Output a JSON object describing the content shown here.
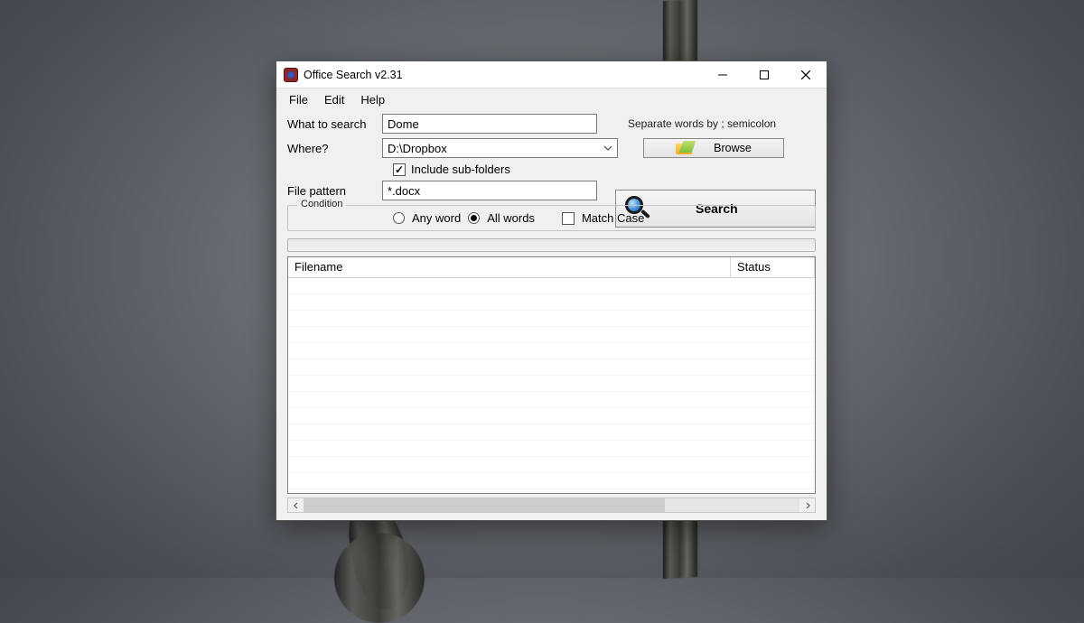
{
  "window": {
    "title": "Office Search v2.31"
  },
  "menu": {
    "file": "File",
    "edit": "Edit",
    "help": "Help"
  },
  "form": {
    "what_label": "What to search",
    "what_value": "Dome",
    "hint": "Separate words by ; semicolon",
    "where_label": "Where?",
    "where_value": "D:\\Dropbox",
    "browse_label": "Browse",
    "include_sub_label": "Include sub-folders",
    "include_sub_checked": true,
    "pattern_label": "File pattern",
    "pattern_value": "*.docx",
    "search_label": "Search"
  },
  "condition": {
    "legend": "Condition",
    "any_word": "Any word",
    "all_words": "All words",
    "selected": "all",
    "match_case_label": "Match Case",
    "match_case_checked": false
  },
  "results": {
    "col_filename": "Filename",
    "col_status": "Status"
  }
}
